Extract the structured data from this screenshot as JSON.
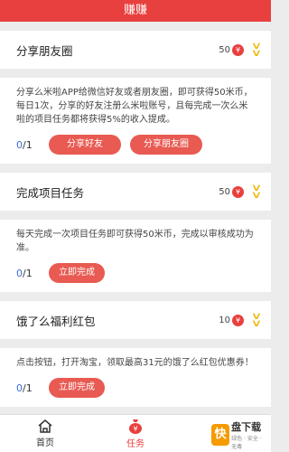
{
  "header": {
    "title": "赚赚"
  },
  "tasks": [
    {
      "title": "分享朋友圈",
      "reward": "50",
      "coin_icon": "¥",
      "description": "分享么米啦APP给微信好友或者朋友圈，即可获得50米币，每日1次，分享的好友注册么米啦账号，且每完成一次么米啦的项目任务都将获得5%的收入提成。",
      "done": "0",
      "total": "/1",
      "buttons": [
        "分享好友",
        "分享朋友圈"
      ]
    },
    {
      "title": "完成项目任务",
      "reward": "50",
      "coin_icon": "¥",
      "description": "每天完成一次项目任务即可获得50米币，完成以审核成功为准。",
      "done": "0",
      "total": "/1",
      "buttons": [
        "立即完成"
      ]
    },
    {
      "title": "饿了么福利红包",
      "reward": "10",
      "coin_icon": "¥",
      "description": "点击按钮，打开淘宝，领取最高31元的饿了么红包优惠券！",
      "done": "0",
      "total": "/1",
      "buttons": [
        "立即完成"
      ]
    }
  ],
  "tabbar": {
    "items": [
      {
        "label": "首页",
        "icon": "home-icon"
      },
      {
        "label": "任务",
        "icon": "money-bag-icon"
      },
      {
        "label": "",
        "icon": "user-icon"
      }
    ],
    "active_color": "#e8403e"
  },
  "watermark": {
    "badge": "快",
    "title": "盘下载",
    "sub": "绿色 · 安全 · 无毒"
  },
  "colors": {
    "accent": "#e8403e",
    "button": "#e85a52",
    "chevron": "#f0b400",
    "count": "#3a6bd1"
  }
}
